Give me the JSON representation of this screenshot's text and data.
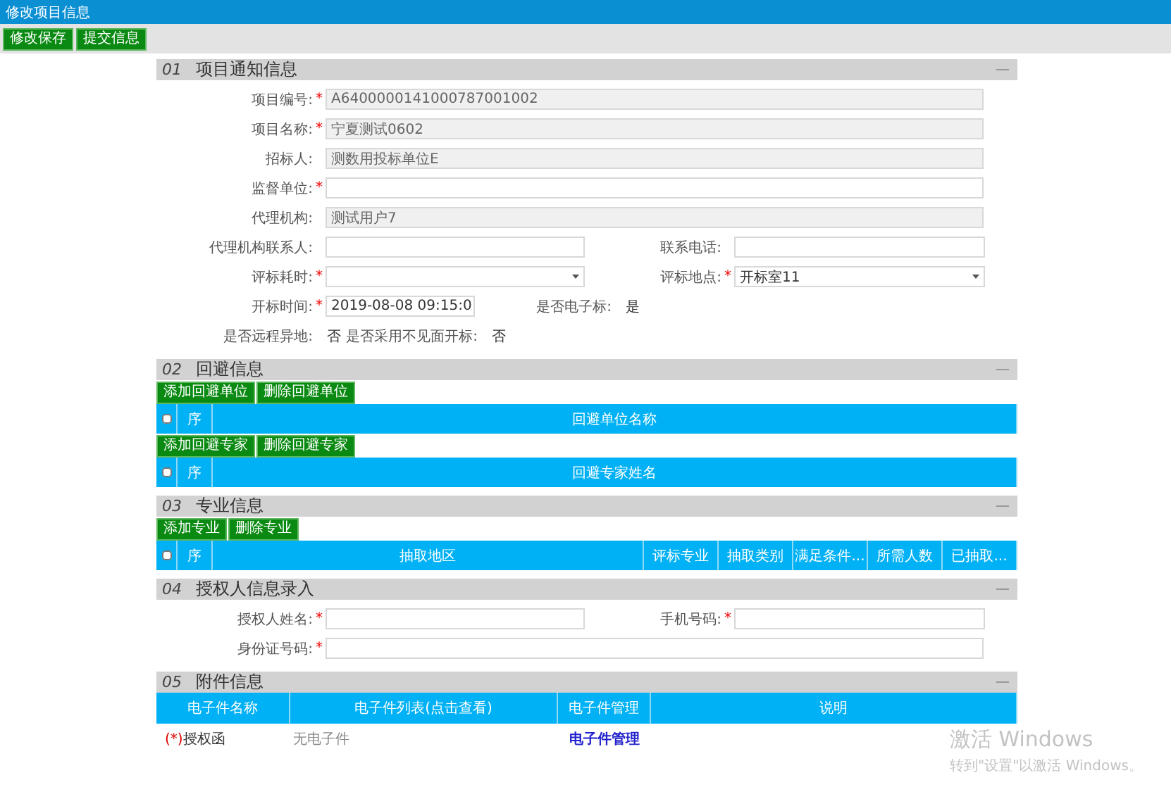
{
  "window": {
    "title": "修改项目信息"
  },
  "toolbar": [
    "修改保存",
    "提交信息"
  ],
  "sections": [
    {
      "number": "01",
      "title": "项目通知信息",
      "kind": "form",
      "rows": [
        {
          "fields": [
            {
              "label": "项目编号:",
              "required_mark": "*",
              "kind": "readonly",
              "value": "A6400000141000787001002"
            }
          ]
        },
        {
          "fields": [
            {
              "label": "项目名称:",
              "required_mark": "*",
              "kind": "readonly",
              "value": "宁夏测试0602"
            }
          ]
        },
        {
          "fields": [
            {
              "label": "招标人:",
              "kind": "readonly",
              "value": "测数用投标单位E"
            }
          ]
        },
        {
          "fields": [
            {
              "label": "监督单位:",
              "required_mark": "*",
              "kind": "input"
            }
          ]
        },
        {
          "fields": [
            {
              "label": "代理机构:",
              "kind": "readonly",
              "value": "测试用户7"
            }
          ]
        },
        {
          "fields": [
            {
              "label": "代理机构联系人:",
              "kind": "input"
            },
            {
              "label": "联系电话:",
              "kind": "input"
            }
          ]
        },
        {
          "fields": [
            {
              "label": "评标耗时:",
              "required_mark": "*",
              "kind": "select"
            },
            {
              "label": "评标地点:",
              "required_mark": "*",
              "kind": "select",
              "value": "开标室11"
            }
          ]
        },
        {
          "fields": [
            {
              "label": "开标时间:",
              "required_mark": "*",
              "kind": "date",
              "value": "2019-08-08 09:15:0"
            },
            {
              "label": "是否电子标:",
              "kind": "text",
              "value": "是"
            }
          ]
        },
        {
          "fields": [
            {
              "label": "是否远程异地:",
              "kind": "text",
              "value": "否"
            },
            {
              "label": "是否采用不见面开标:",
              "kind": "text",
              "value": "否"
            }
          ]
        }
      ]
    },
    {
      "number": "02",
      "title": "回避信息",
      "kind": "grids",
      "grids": [
        {
          "buttons": [
            "添加回避单位",
            "删除回避单位"
          ],
          "checked": false,
          "columns": [
            "序",
            "回避单位名称"
          ]
        },
        {
          "buttons": [
            "添加回避专家",
            "删除回避专家"
          ],
          "checked": false,
          "columns": [
            "序",
            "回避专家姓名"
          ]
        }
      ]
    },
    {
      "number": "03",
      "title": "专业信息",
      "kind": "grids",
      "grids": [
        {
          "buttons": [
            "添加专业",
            "删除专业"
          ],
          "checked": false,
          "columns": [
            "序",
            "抽取地区",
            "评标专业",
            "抽取类别",
            "满足条件...",
            "所需人数",
            "已抽取..."
          ]
        }
      ]
    },
    {
      "number": "04",
      "title": "授权人信息录入",
      "kind": "form",
      "rows": [
        {
          "fields": [
            {
              "label": "授权人姓名:",
              "required_mark": "*",
              "kind": "input"
            },
            {
              "label": "手机号码:",
              "required_mark": "*",
              "kind": "input"
            }
          ]
        },
        {
          "fields": [
            {
              "label": "身份证号码:",
              "required_mark": "*",
              "kind": "input"
            }
          ]
        }
      ]
    },
    {
      "number": "05",
      "title": "附件信息",
      "kind": "attachments",
      "columns": [
        "电子件名称",
        "电子件列表(点击查看)",
        "电子件管理",
        "说明"
      ],
      "rows": [
        {
          "mark": "(*)",
          "name": "授权函",
          "files": "无电子件",
          "action": "电子件管理"
        }
      ]
    }
  ],
  "overlay": {
    "title": "激活 Windows",
    "subtitle": "转到\"设置\"以激活 Windows。"
  }
}
